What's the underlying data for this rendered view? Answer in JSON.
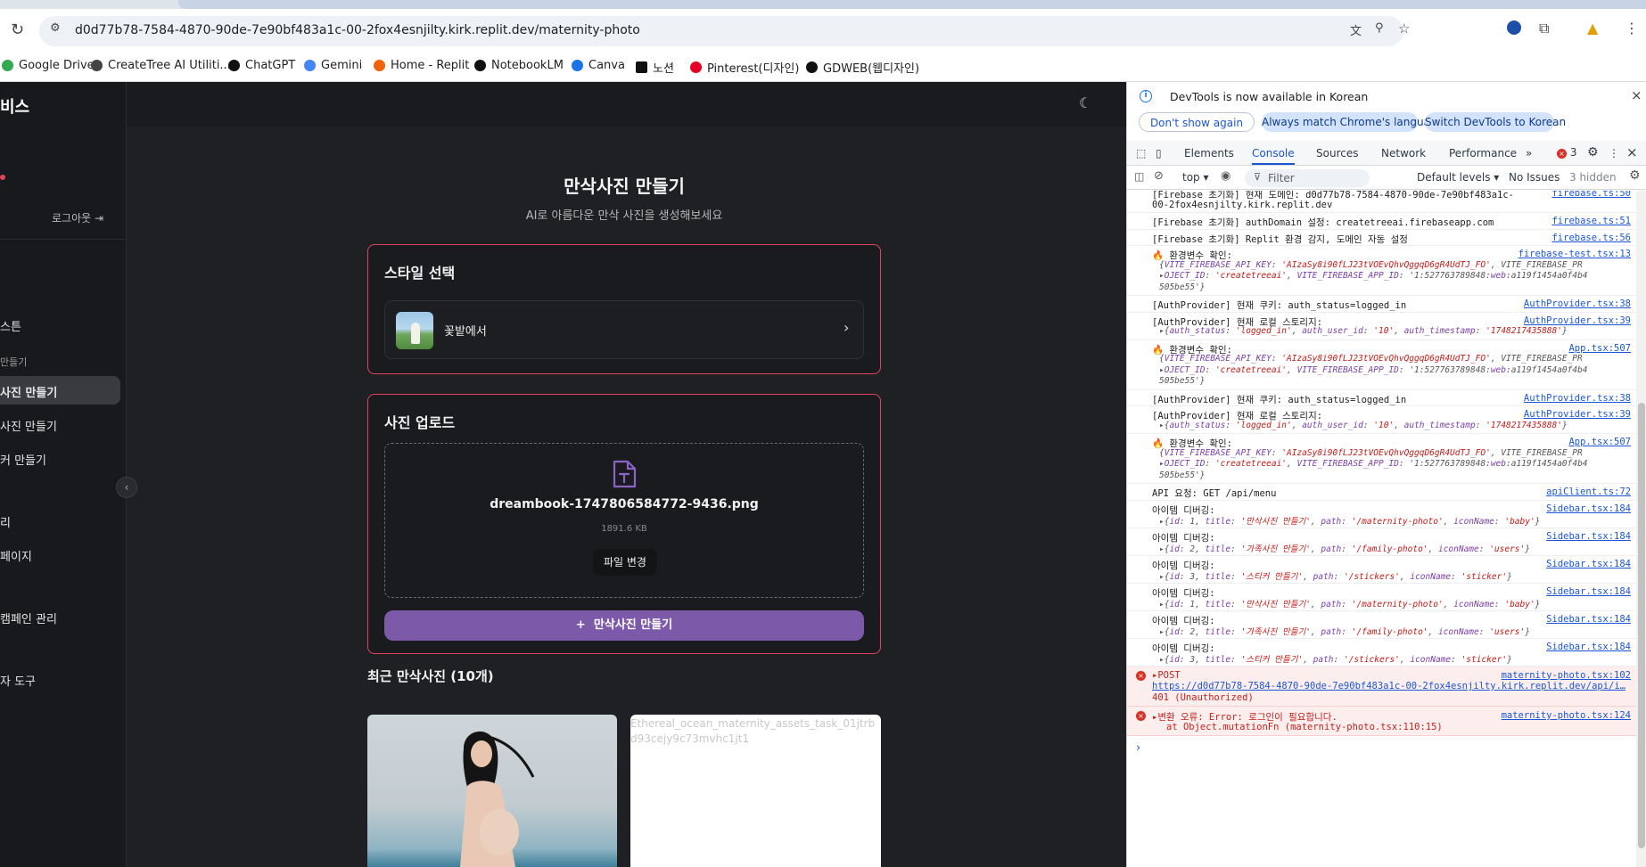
{
  "browser": {
    "url": "d0d77b78-7584-4870-90de-7e90bf483a1c-00-2fox4esnjilty.kirk.replit.dev/maternity-photo",
    "bookmarks": [
      "Google Drive",
      "CreateTree AI Utiliti...",
      "ChatGPT",
      "Gemini",
      "Home - Replit",
      "NotebookLM",
      "Canva",
      "노션",
      "Pinterest(디자인)",
      "GDWEB(웹디자인)"
    ],
    "bookmark_colors": [
      "#34a853",
      "#444444",
      "#111111",
      "#4285f4",
      "#f26207",
      "#111111",
      "#1a73e8",
      "#111111",
      "#e60023",
      "#111111"
    ]
  },
  "sidebar": {
    "brand": "비스",
    "logout": "로그아웃",
    "items": [
      "스튼",
      "만들기",
      "사진 만들기",
      "사진 만들기",
      "커 만들기",
      "리",
      "페이지",
      "캠페인 관리",
      "자 도구"
    ]
  },
  "main": {
    "title": "만삭사진 만들기",
    "subtitle": "AI로 아름다운 만삭 사진을 생성해보세요",
    "style_card": {
      "title": "스타일 선택",
      "selected": "꽃밭에서"
    },
    "upload_card": {
      "title": "사진 업로드",
      "filename": "dreambook-1747806584772-9436.png",
      "filesize": "1891.6 KB",
      "change_button": "파일 변경",
      "make_button": "만삭사진 만들기"
    },
    "recent_title": "최근 만삭사진 (10개)",
    "broken_image_alt": "Ethereal_ocean_maternity_assets_task_01jtrbd93cejy9c73mvhc1jt1"
  },
  "devtools": {
    "notice": "DevTools is now available in Korean",
    "notice_buttons": [
      "Don't show again",
      "Always match Chrome's language",
      "Switch DevTools to Korean"
    ],
    "tabs": [
      "Elements",
      "Console",
      "Sources",
      "Network",
      "Performance"
    ],
    "error_count": "3",
    "filter": {
      "context": "top",
      "placeholder": "Filter",
      "levels": "Default levels",
      "issues": "No Issues",
      "hidden": "3 hidden"
    },
    "logs": [
      {
        "msg": "[Firebase 초기화] 현재 도메인: d0d77b78-7584-4870-90de-7e90bf483a1c-",
        "msg2": "00-2fox4esnjilty.kirk.replit.dev",
        "src": "firebase.ts:50"
      },
      {
        "msg": "[Firebase 초기화] authDomain 설정: createtreeai.firebaseapp.com",
        "src": "firebase.ts:51"
      },
      {
        "msg": "[Firebase 초기화] Replit 환경 감지, 도메인 자동 설정",
        "src": "firebase.ts:56"
      },
      {
        "msg": "🔥 환경변수 확인:",
        "src": "firebase-test.tsx:13",
        "sub1": "{VITE_FIREBASE_API_KEY: 'AIzaSy8i90fLJ23tVOEvQhvQggqD6gR4UdTJ_FO', VITE_FIREBASE_PR",
        "sub2": "▸OJECT_ID: 'createtreeai', VITE_FIREBASE_APP_ID: '1:527763789848:web:a119f1454a0f4b4",
        "sub3": "505be55'}"
      },
      {
        "msg": "[AuthProvider] 현재 쿠키: auth_status=logged_in",
        "src": "AuthProvider.tsx:38"
      },
      {
        "msg": "[AuthProvider] 현재 로컬 스토리지:",
        "src": "AuthProvider.tsx:39",
        "sub1": "▸{auth_status: 'logged_in', auth_user_id: '10', auth_timestamp: '1748217435888'}"
      },
      {
        "msg": "🔥 환경변수 확인:",
        "src": "App.tsx:507",
        "sub1": "{VITE_FIREBASE_API_KEY: 'AIzaSy8i90fLJ23tVOEvQhvQggqD6gR4UdTJ_FO', VITE_FIREBASE_PR",
        "sub2": "▸OJECT_ID: 'createtreeai', VITE_FIREBASE_APP_ID: '1:527763789848:web:a119f1454a0f4b4",
        "sub3": "505be55'}"
      },
      {
        "msg": "[AuthProvider] 현재 쿠키: auth_status=logged_in",
        "src": "AuthProvider.tsx:38"
      },
      {
        "msg": "[AuthProvider] 현재 로컬 스토리지:",
        "src": "AuthProvider.tsx:39",
        "sub1": "▸{auth_status: 'logged_in', auth_user_id: '10', auth_timestamp: '1748217435888'}"
      },
      {
        "msg": "🔥 환경변수 확인:",
        "src": "App.tsx:507",
        "sub1": "{VITE_FIREBASE_API_KEY: 'AIzaSy8i90fLJ23tVOEvQhvQggqD6gR4UdTJ_FO', VITE_FIREBASE_PR",
        "sub2": "▸OJECT_ID: 'createtreeai', VITE_FIREBASE_APP_ID: '1:527763789848:web:a119f1454a0f4b4",
        "sub3": "505be55'}"
      },
      {
        "msg": "API 요청: GET /api/menu",
        "src": "apiClient.ts:72"
      },
      {
        "msg": "아이템 디버깅:",
        "src": "Sidebar.tsx:184",
        "sub1": "▸{id: 1, title: '만삭사진 만들기', path: '/maternity-photo', iconName: 'baby'}"
      },
      {
        "msg": "아이템 디버깅:",
        "src": "Sidebar.tsx:184",
        "sub1": "▸{id: 2, title: '가족사진 만들기', path: '/family-photo', iconName: 'users'}"
      },
      {
        "msg": "아이템 디버깅:",
        "src": "Sidebar.tsx:184",
        "sub1": "▸{id: 3, title: '스티커 만들기', path: '/stickers', iconName: 'sticker'}"
      },
      {
        "msg": "아이템 디버깅:",
        "src": "Sidebar.tsx:184",
        "sub1": "▸{id: 1, title: '만삭사진 만들기', path: '/maternity-photo', iconName: 'baby'}"
      },
      {
        "msg": "아이템 디버깅:",
        "src": "Sidebar.tsx:184",
        "sub1": "▸{id: 2, title: '가족사진 만들기', path: '/family-photo', iconName: 'users'}"
      },
      {
        "msg": "아이템 디버깅:",
        "src": "Sidebar.tsx:184",
        "sub1": "▸{id: 3, title: '스티커 만들기', path: '/stickers', iconName: 'sticker'}"
      }
    ],
    "errors": [
      {
        "msg": "▸POST",
        "link": "https://d0d77b78-7584-4870-90de-7e90bf483a1c-00-2fox4esnjilty.kirk.replit.dev/api/i…",
        "status": "401 (Unauthorized)",
        "src": "maternity-photo.tsx:102"
      },
      {
        "msg": "▸변환 오류: Error: 로그인이 필요합니다.",
        "trace": "at Object.mutationFn (maternity-photo.tsx:110:15)",
        "src": "maternity-photo.tsx:124"
      }
    ],
    "prompt": "›"
  },
  "colors": {
    "accent_border": "#e0455f",
    "primary_button": "#7d5aa9",
    "link": "#1a56d6",
    "error": "#d93025"
  }
}
